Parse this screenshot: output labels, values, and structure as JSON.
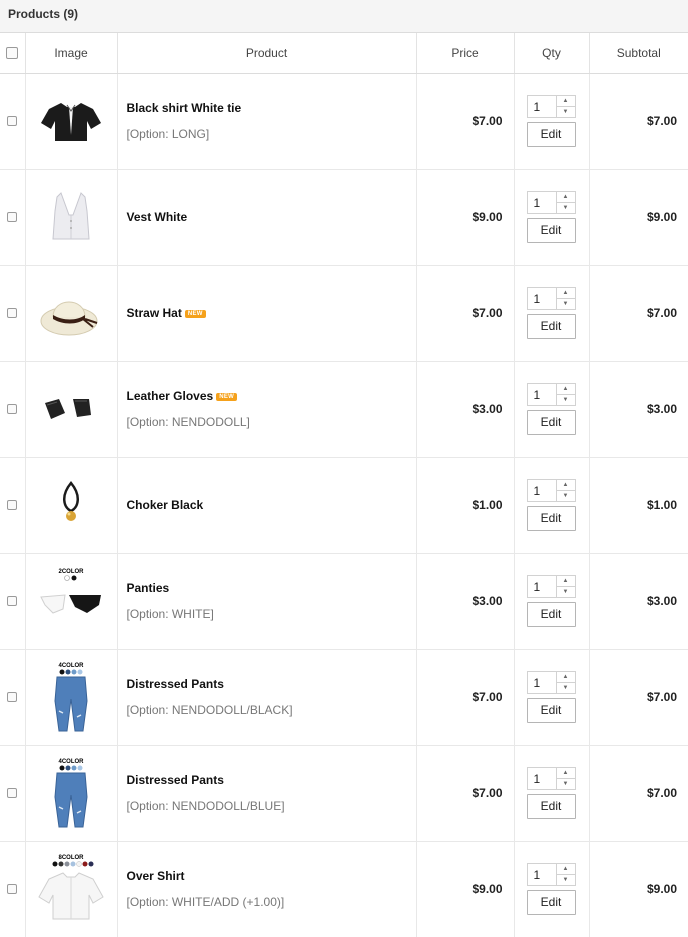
{
  "cart": {
    "title": "Products (9)",
    "columns": {
      "image": "Image",
      "product": "Product",
      "price": "Price",
      "qty": "Qty",
      "subtotal": "Subtotal"
    },
    "edit_label": "Edit",
    "new_badge": "NEW",
    "items": [
      {
        "name": "Black shirt White tie",
        "option": "[Option: LONG]",
        "price": "$7.00",
        "qty": "1",
        "subtotal": "$7.00",
        "image": "black-shirt-icon"
      },
      {
        "name": "Vest White",
        "option": "",
        "price": "$9.00",
        "qty": "1",
        "subtotal": "$9.00",
        "image": "white-vest-icon"
      },
      {
        "name": "Straw Hat",
        "option": "",
        "price": "$7.00",
        "qty": "1",
        "subtotal": "$7.00",
        "image": "straw-hat-icon",
        "is_new": true
      },
      {
        "name": "Leather Gloves",
        "option": "[Option: NENDODOLL]",
        "price": "$3.00",
        "qty": "1",
        "subtotal": "$3.00",
        "image": "leather-gloves-icon",
        "is_new": true
      },
      {
        "name": "Choker Black",
        "option": "",
        "price": "$1.00",
        "qty": "1",
        "subtotal": "$1.00",
        "image": "choker-icon"
      },
      {
        "name": "Panties",
        "option": "[Option: WHITE]",
        "price": "$3.00",
        "qty": "1",
        "subtotal": "$3.00",
        "image": "panties-icon",
        "color_label": "2COLOR"
      },
      {
        "name": "Distressed Pants",
        "option": "[Option: NENDODOLL/BLACK]",
        "price": "$7.00",
        "qty": "1",
        "subtotal": "$7.00",
        "image": "jeans-icon",
        "color_label": "4COLOR"
      },
      {
        "name": "Distressed Pants",
        "option": "[Option: NENDODOLL/BLUE]",
        "price": "$7.00",
        "qty": "1",
        "subtotal": "$7.00",
        "image": "jeans-icon",
        "color_label": "4COLOR"
      },
      {
        "name": "Over Shirt",
        "option": "[Option: WHITE/ADD (+1.00)]",
        "price": "$9.00",
        "qty": "1",
        "subtotal": "$9.00",
        "image": "white-shirt-icon",
        "color_label": "8COLOR"
      }
    ]
  },
  "colors": {
    "header_bg": "#f5f5f5",
    "border": "#e3e3e3",
    "badge": "#f5a11b",
    "option_text": "#777777"
  }
}
